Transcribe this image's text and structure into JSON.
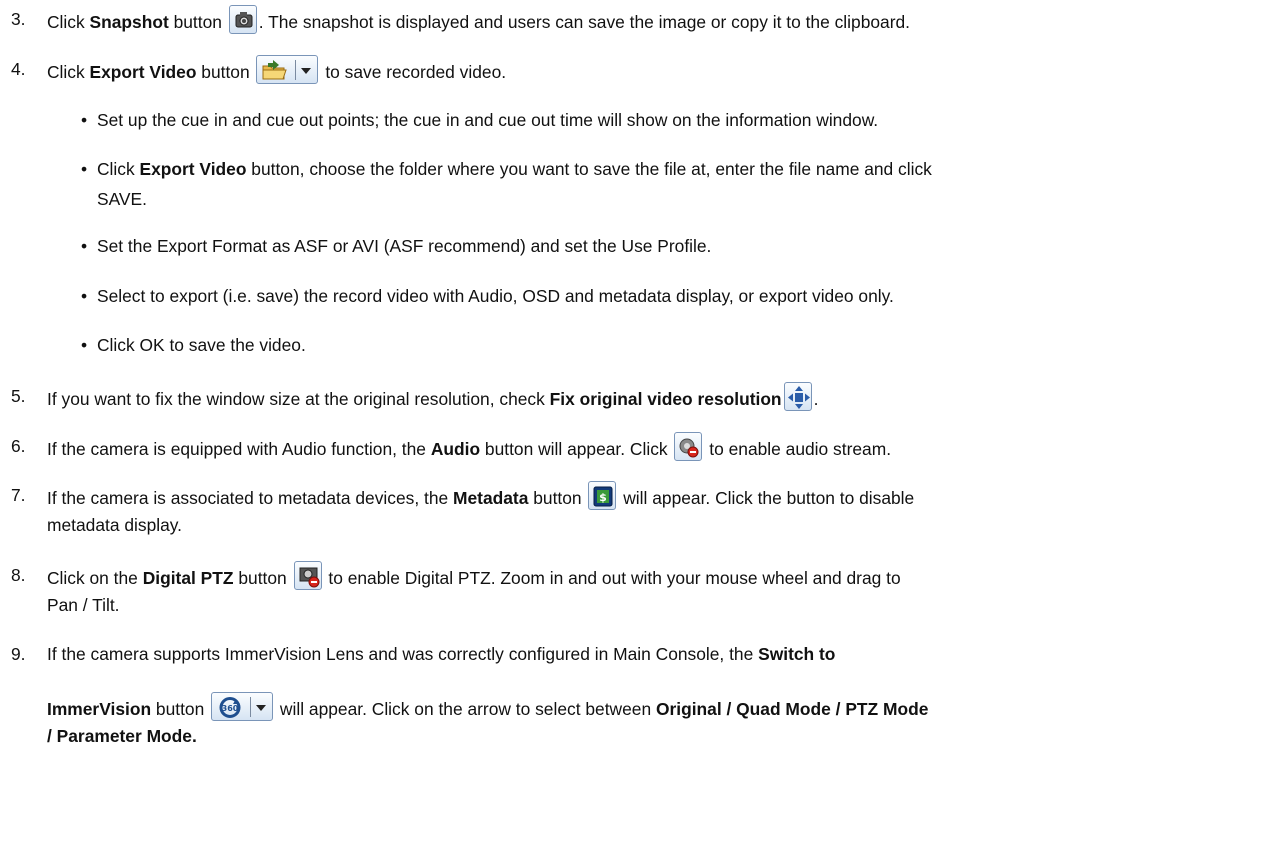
{
  "steps": [
    {
      "num": "3.",
      "t1": "Click ",
      "b1": "Snapshot",
      "t2": " button ",
      "icon": "camera-icon",
      "t3": ". The snapshot is displayed and users can save the image or copy it to the clipboard."
    },
    {
      "num": "4.",
      "t1": "Click ",
      "b1": "Export Video",
      "t2": " button ",
      "icon": "folder-export-icon",
      "t3": " to save recorded video."
    },
    {
      "num": "5.",
      "t1": "If you want to fix the window size at the original resolution, check ",
      "b1": "Fix original video resolution",
      "icon": "resize-arrows-icon",
      "t3": "."
    },
    {
      "num": "6.",
      "t1": "If the camera is equipped with Audio function, the ",
      "b1": "Audio",
      "t2": " button will appear. Click ",
      "icon": "speaker-muted-icon",
      "t3": " to enable audio stream."
    },
    {
      "num": "7.",
      "t1": "If the camera is associated to metadata devices, the ",
      "b1": "Metadata",
      "t2": " button ",
      "icon": "dollar-icon",
      "t3": " will appear. Click the button to disable",
      "l2": "metadata display."
    },
    {
      "num": "8.",
      "t1": "Click on the ",
      "b1": "Digital PTZ",
      "t2": " button ",
      "icon": "digital-ptz-icon",
      "t3": " to enable Digital PTZ.  Zoom in and out with your mouse wheel and drag to",
      "l2": "Pan / Tilt."
    },
    {
      "num": "9.",
      "t1": "If the camera supports ImmerVision Lens and was correctly configured in Main Console, the ",
      "b1": "Switch to",
      "b2": "ImmerVision",
      "t2": " button ",
      "icon": "360-icon",
      "t3": " will appear.   Click on the arrow to select between ",
      "b3": "Original / Quad Mode / PTZ Mode",
      "b4": "/ Parameter Mode."
    }
  ],
  "export_bullets": [
    {
      "dot": "•",
      "text": "Set up the cue in and cue out points; the cue in and cue out time will show on the information window."
    },
    {
      "dot": "•",
      "t1": "Click ",
      "b1": "Export Video",
      "t2": " button, choose the folder where you want to save the file at, enter the file name and click",
      "l2": "SAVE."
    },
    {
      "dot": "•",
      "text": "Set the Export Format as ASF or AVI (ASF recommend) and set the Use Profile."
    },
    {
      "dot": "•",
      "text": "Select to export (i.e. save) the record video with Audio, OSD and metadata display, or export video only."
    },
    {
      "dot": "•",
      "text": "Click OK to save the video."
    }
  ]
}
